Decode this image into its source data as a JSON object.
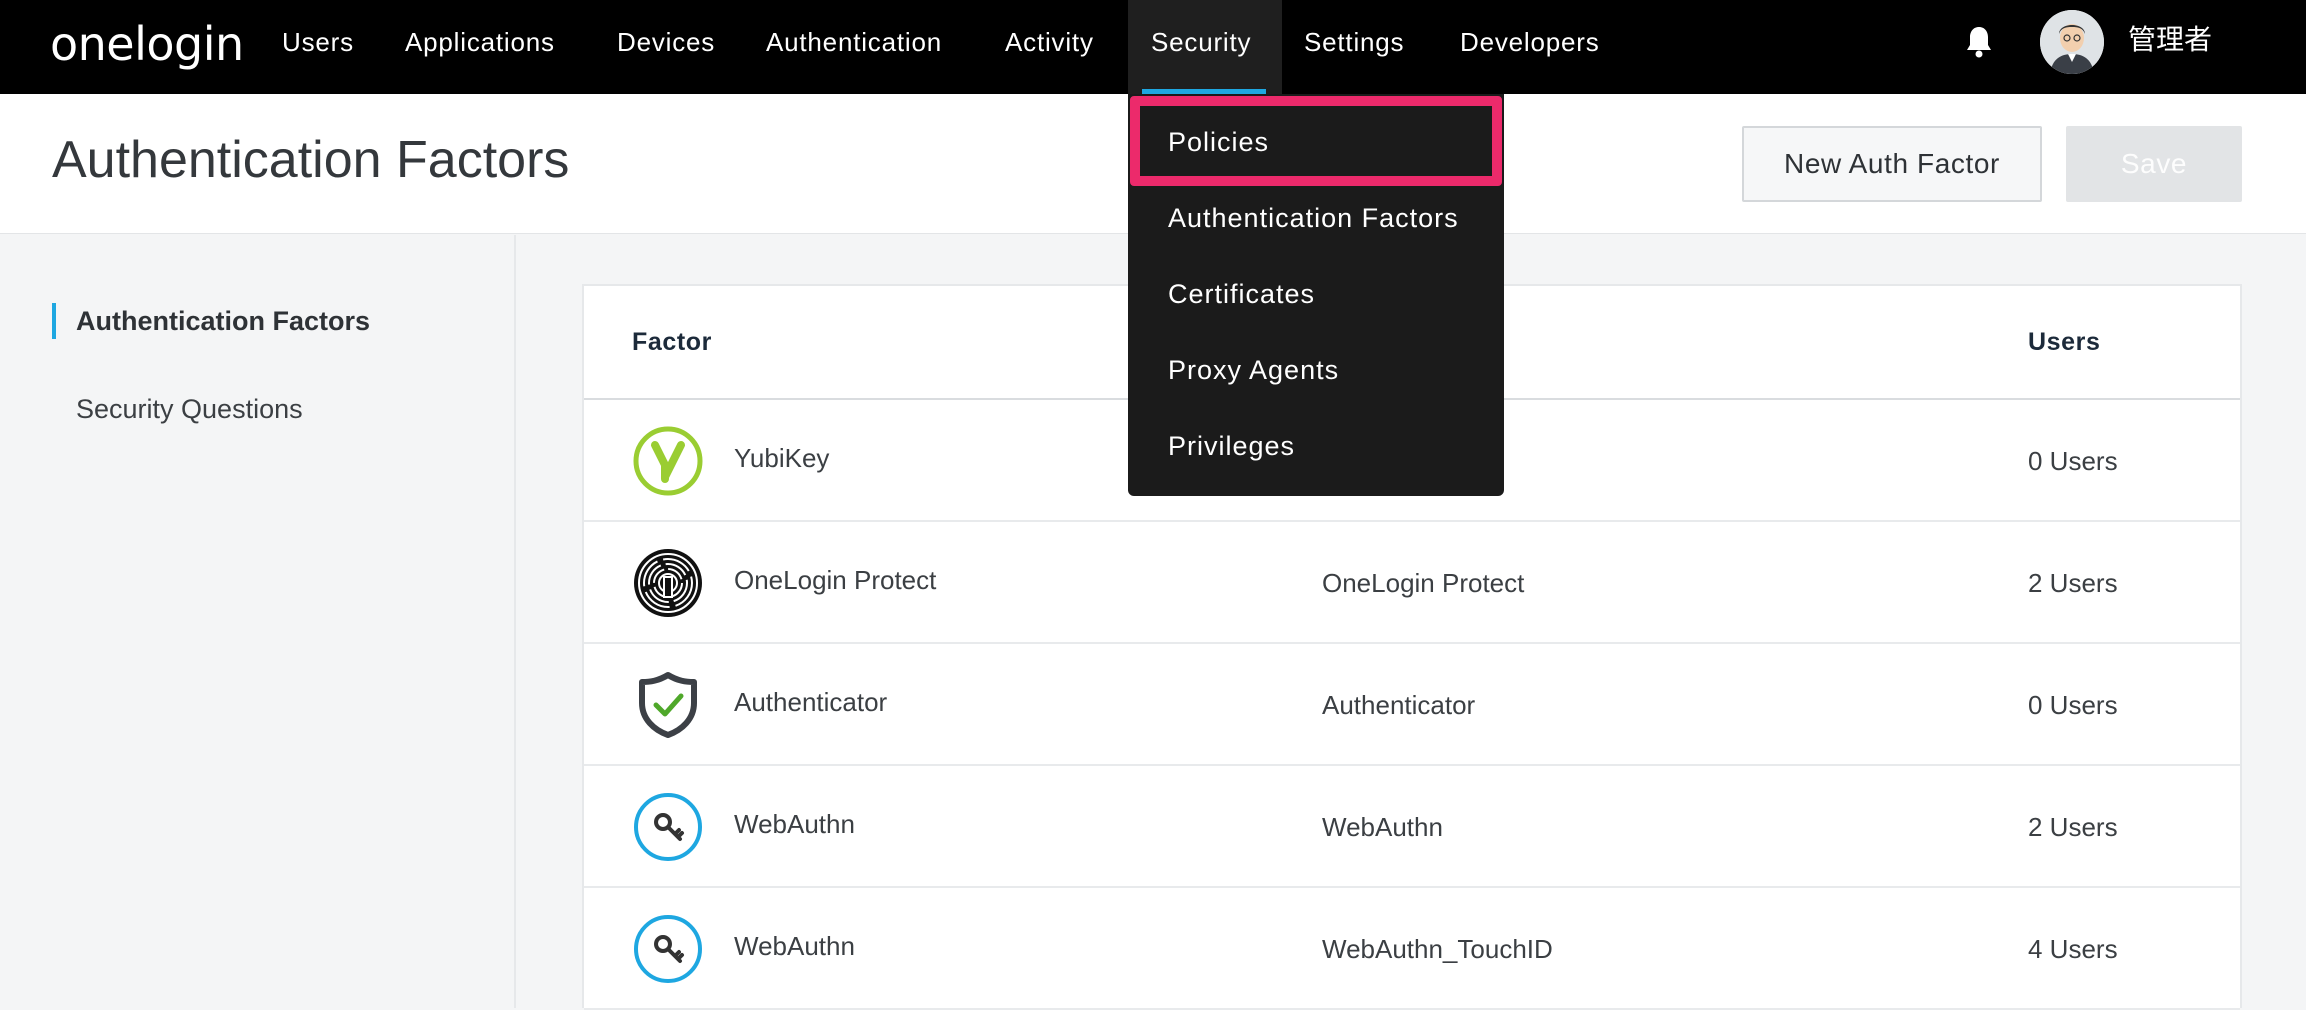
{
  "brand": {
    "name": "onelogin"
  },
  "nav": {
    "items": [
      {
        "label": "Users"
      },
      {
        "label": "Applications"
      },
      {
        "label": "Devices"
      },
      {
        "label": "Authentication"
      },
      {
        "label": "Activity"
      },
      {
        "label": "Security",
        "active": true
      },
      {
        "label": "Settings"
      },
      {
        "label": "Developers"
      }
    ],
    "user_name": "管理者",
    "icons": {
      "notifications": "bell-icon",
      "profile": "avatar"
    }
  },
  "header": {
    "title": "Authentication Factors",
    "new_button_label": "New Auth Factor",
    "save_button_label": "Save"
  },
  "sidebar": {
    "items": [
      {
        "label": "Authentication Factors",
        "active": true
      },
      {
        "label": "Security Questions"
      }
    ]
  },
  "security_menu": {
    "items": [
      {
        "label": "Policies",
        "highlighted": true
      },
      {
        "label": "Authentication Factors"
      },
      {
        "label": "Certificates"
      },
      {
        "label": "Proxy Agents"
      },
      {
        "label": "Privileges"
      }
    ],
    "highlight_color": "#ec2a6b"
  },
  "table": {
    "columns": [
      "Factor",
      "Users"
    ],
    "rows": [
      {
        "icon": "yubikey-icon",
        "factor": "YubiKey",
        "name": "",
        "users": "0 Users"
      },
      {
        "icon": "fingerprint-icon",
        "factor": "OneLogin Protect",
        "name": "OneLogin Protect",
        "users": "2 Users"
      },
      {
        "icon": "shield-check-icon",
        "factor": "Authenticator",
        "name": "Authenticator",
        "users": "0 Users"
      },
      {
        "icon": "key-icon",
        "factor": "WebAuthn",
        "name": "WebAuthn",
        "users": "2 Users"
      },
      {
        "icon": "key-icon",
        "factor": "WebAuthn",
        "name": "WebAuthn_TouchID",
        "users": "4 Users"
      }
    ]
  },
  "colors": {
    "accent": "#1ea7e1",
    "nav_bg": "#000000",
    "yubikey_green": "#9acd32",
    "authenticator_green": "#4fa82a"
  }
}
